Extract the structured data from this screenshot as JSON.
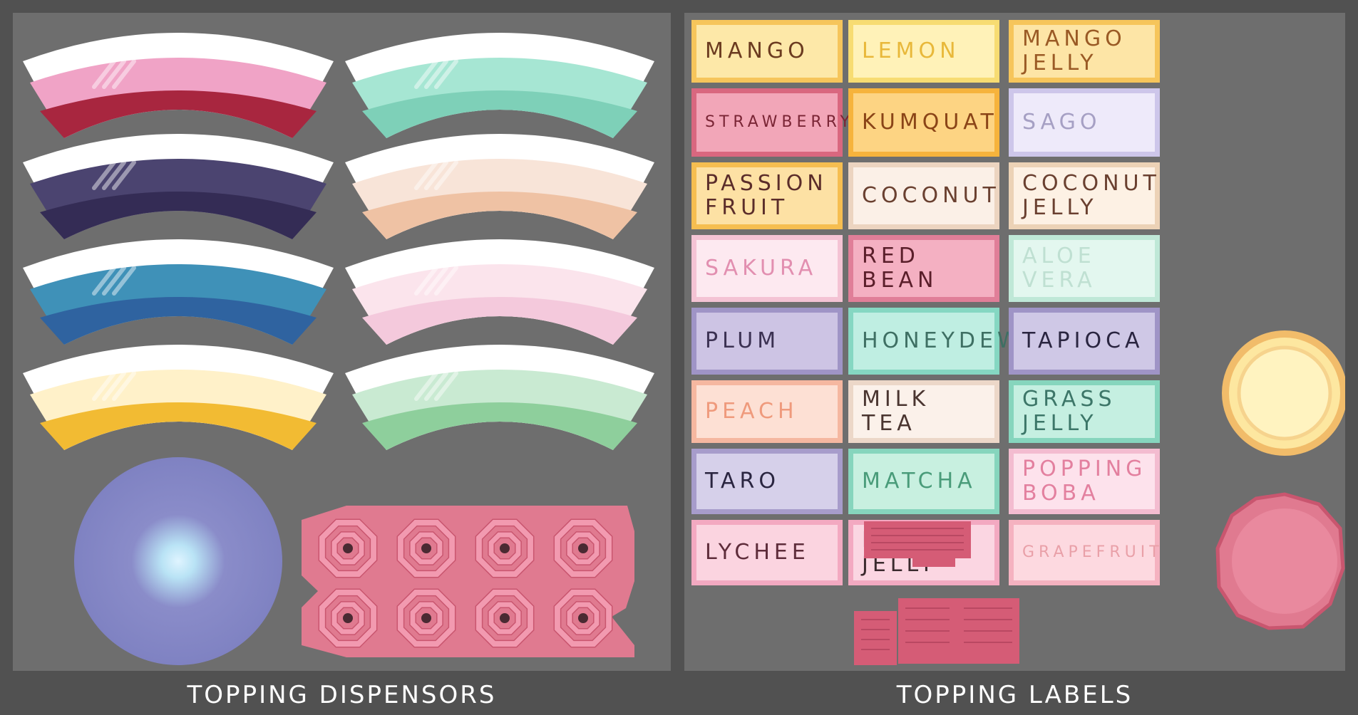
{
  "captions": {
    "left": "TOPPING DISPENSORS",
    "right": "TOPPING LABELS"
  },
  "colors": {
    "background": "#515151",
    "panel": "#6e6e6e",
    "caption": "#ffffff"
  },
  "dispensers": [
    {
      "name": "strawberry-boba",
      "top": "#f0a3c6",
      "bottom": "#a8263f"
    },
    {
      "name": "mint-jelly",
      "top": "#a6e6d3",
      "bottom": "#7ed0b8"
    },
    {
      "name": "blueberry-boba",
      "top": "#4b4470",
      "bottom": "#342c55"
    },
    {
      "name": "peach-jelly",
      "top": "#f8e4d8",
      "bottom": "#efc2a4"
    },
    {
      "name": "ocean-boba",
      "top": "#3f91b8",
      "bottom": "#2f63a0"
    },
    {
      "name": "pink-jelly",
      "top": "#fbe4ec",
      "bottom": "#f4c9dc"
    },
    {
      "name": "mango-jelly",
      "top": "#fff1c9",
      "bottom": "#f2bb33"
    },
    {
      "name": "green-jelly",
      "top": "#c9ead2",
      "bottom": "#8ecf9c"
    }
  ],
  "labels": [
    {
      "name": "mango",
      "text": "MANGO",
      "bg": "#fde8a8",
      "border": "#f6c55b",
      "ink": "#6b3b20"
    },
    {
      "name": "lemon",
      "text": "LEMON",
      "bg": "#fff2b8",
      "border": "#f7dc72",
      "ink": "#e8b83a"
    },
    {
      "name": "mango-jelly",
      "text": "MANGO\nJELLY",
      "bg": "#fde5a6",
      "border": "#f6c55b",
      "ink": "#9a5a25"
    },
    {
      "name": "strawberry",
      "text": "STRAWBERRY",
      "bg": "#f2a6b8",
      "border": "#d9677f",
      "ink": "#7a2535"
    },
    {
      "name": "kumquat",
      "text": "KUMQUAT",
      "bg": "#fdd483",
      "border": "#f6b33c",
      "ink": "#8a4417"
    },
    {
      "name": "sago",
      "text": "SAGO",
      "bg": "#eeeafa",
      "border": "#cdc6ea",
      "ink": "#a6a0c4"
    },
    {
      "name": "passion-fruit",
      "text": "PASSION\nFRUIT",
      "bg": "#fde1a4",
      "border": "#f6be50",
      "ink": "#5b2d2a"
    },
    {
      "name": "coconut",
      "text": "COCONUT",
      "bg": "#fbf0e7",
      "border": "#ecd4c0",
      "ink": "#6a4030"
    },
    {
      "name": "coconut-jelly",
      "text": "COCONUT\nJELLY",
      "bg": "#fdf1e4",
      "border": "#ecd2b6",
      "ink": "#6a4030"
    },
    {
      "name": "sakura",
      "text": "SAKURA",
      "bg": "#fde9f0",
      "border": "#f4c3d4",
      "ink": "#e28fb0"
    },
    {
      "name": "red-bean",
      "text": "RED\nBEAN",
      "bg": "#f4b0c2",
      "border": "#e07e98",
      "ink": "#5a1e2a"
    },
    {
      "name": "aloe-vera",
      "text": "ALOE\nVERA",
      "bg": "#e3f7ef",
      "border": "#bfe8d7",
      "ink": "#bfe0d2"
    },
    {
      "name": "plum",
      "text": "PLUM",
      "bg": "#cdc4e4",
      "border": "#9f94c6",
      "ink": "#3b3152"
    },
    {
      "name": "honeydew",
      "text": "HONEYDEW",
      "bg": "#bfeee2",
      "border": "#85d7c2",
      "ink": "#3e6f63"
    },
    {
      "name": "tapioca",
      "text": "TAPIOCA",
      "bg": "#cfc8e6",
      "border": "#9f94c6",
      "ink": "#2a2540"
    },
    {
      "name": "peach",
      "text": "PEACH",
      "bg": "#fde0d4",
      "border": "#f5b7a0",
      "ink": "#ef9a7c"
    },
    {
      "name": "milk-tea",
      "text": "MILK TEA",
      "bg": "#fbf1ea",
      "border": "#ecd7c8",
      "ink": "#4a3530"
    },
    {
      "name": "grass-jelly",
      "text": "GRASS\nJELLY",
      "bg": "#c5efe1",
      "border": "#86d5bd",
      "ink": "#3c7668"
    },
    {
      "name": "taro",
      "text": "TARO",
      "bg": "#d6d0ea",
      "border": "#a79ccb",
      "ink": "#2a2540"
    },
    {
      "name": "matcha",
      "text": "MATCHA",
      "bg": "#c8f0e0",
      "border": "#86d5bd",
      "ink": "#4a9c7a"
    },
    {
      "name": "popping-boba",
      "text": "POPPING\nBOBA",
      "bg": "#fde2ec",
      "border": "#f3bcd0",
      "ink": "#e3809f"
    },
    {
      "name": "lychee",
      "text": "LYCHEE",
      "bg": "#fbd4e0",
      "border": "#f3a9c1",
      "ink": "#5e2c3a"
    },
    {
      "name": "lychee-jelly",
      "text": "LYCHEE\nJELLY",
      "bg": "#fbd6e2",
      "border": "#f3a9c1",
      "ink": "#3b2a2e"
    },
    {
      "name": "grapefruit",
      "text": "GRAPEFRUIT",
      "bg": "#fdd9e0",
      "border": "#f5b2c0",
      "ink": "#e9a0a8"
    }
  ]
}
